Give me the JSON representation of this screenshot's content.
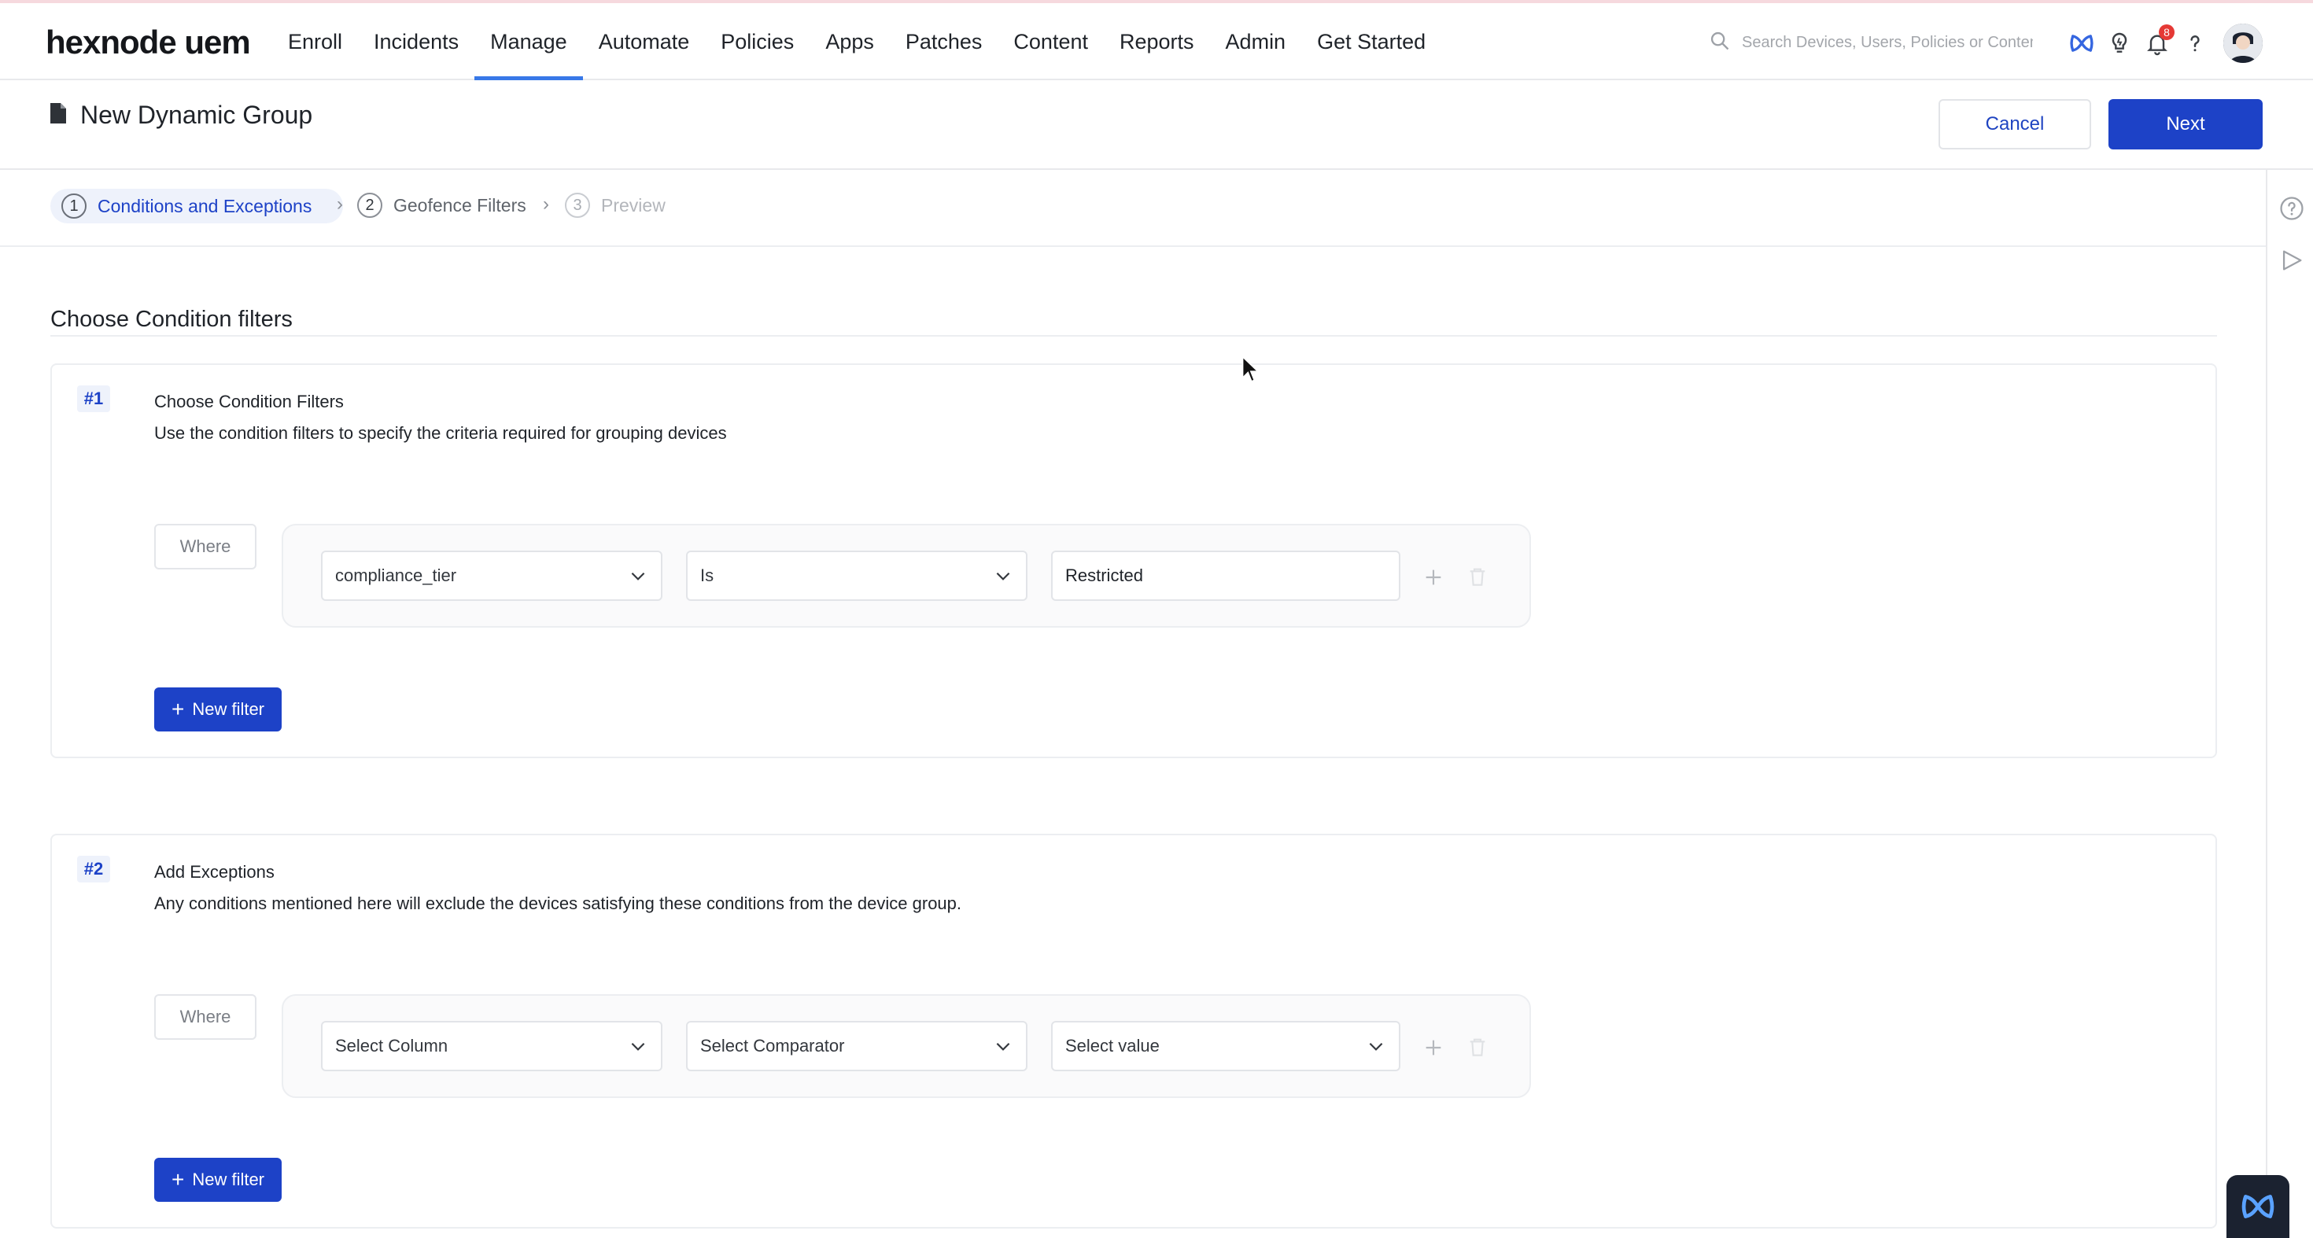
{
  "brand": {
    "logo_text": "hexnode uem"
  },
  "nav": {
    "items": [
      {
        "label": "Enroll"
      },
      {
        "label": "Incidents"
      },
      {
        "label": "Manage"
      },
      {
        "label": "Automate"
      },
      {
        "label": "Policies"
      },
      {
        "label": "Apps"
      },
      {
        "label": "Patches"
      },
      {
        "label": "Content"
      },
      {
        "label": "Reports"
      },
      {
        "label": "Admin"
      },
      {
        "label": "Get Started"
      }
    ],
    "active": "Manage"
  },
  "search": {
    "placeholder": "Search Devices, Users, Policies or Content",
    "value": ""
  },
  "notifications": {
    "count": "8"
  },
  "colors": {
    "accent": "#1d42c7",
    "nav_underline": "#3878e8",
    "badge": "#e53935"
  },
  "page": {
    "title": "New Dynamic Group",
    "cancel_label": "Cancel",
    "next_label": "Next"
  },
  "steps": [
    {
      "num": "1",
      "label": "Conditions and Exceptions",
      "state": "active"
    },
    {
      "num": "2",
      "label": "Geofence Filters",
      "state": "normal"
    },
    {
      "num": "3",
      "label": "Preview",
      "state": "disabled"
    }
  ],
  "section": {
    "title": "Choose Condition filters"
  },
  "conditions": {
    "num": "#1",
    "heading": "Choose Condition Filters",
    "description": "Use the condition filters to specify the criteria required for grouping devices",
    "where_label": "Where",
    "column": "compliance_tier",
    "comparator": "Is",
    "value": "Restricted",
    "new_filter_label": "New filter"
  },
  "exceptions": {
    "num": "#2",
    "heading": "Add Exceptions",
    "description": "Any conditions mentioned here will exclude the devices satisfying these conditions from the device group.",
    "where_label": "Where",
    "column": "Select Column",
    "comparator": "Select Comparator",
    "value": "Select value",
    "new_filter_label": "New filter"
  }
}
